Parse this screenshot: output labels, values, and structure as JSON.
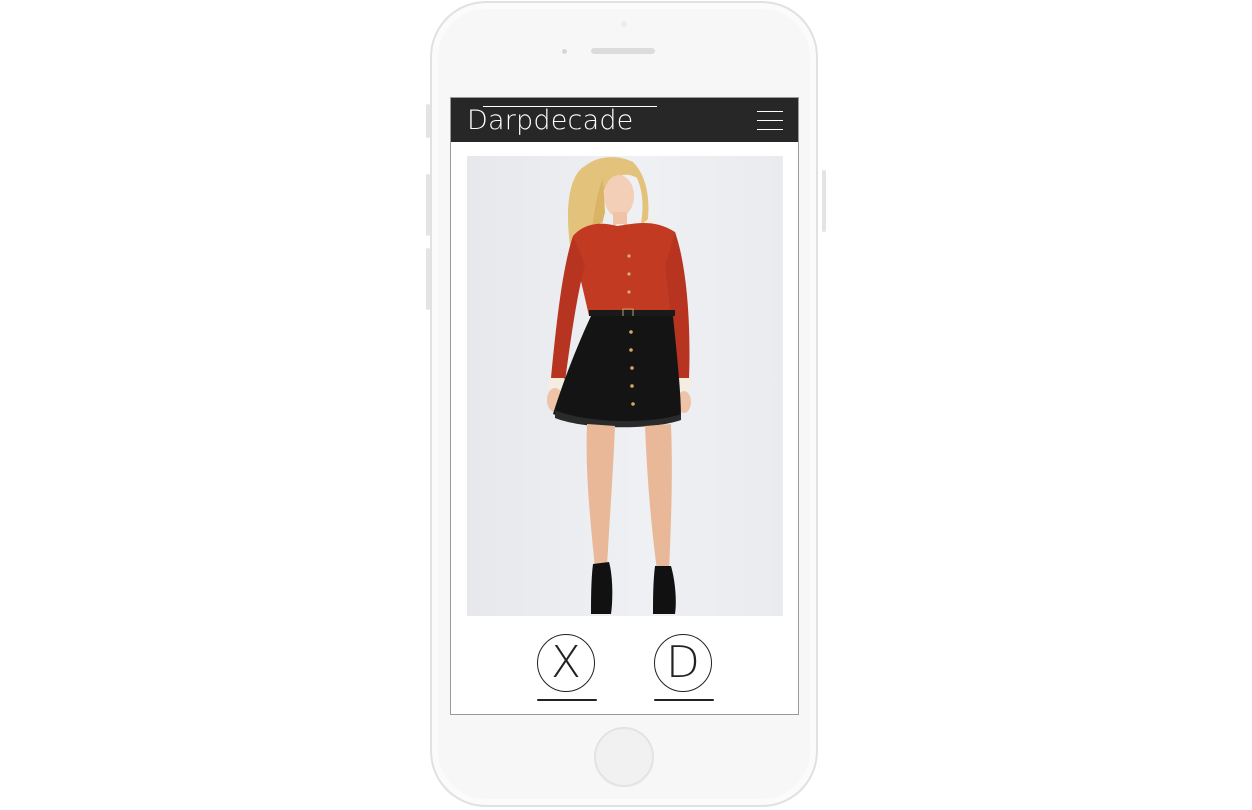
{
  "app": {
    "logo_text": "Darpdecade"
  },
  "actions": {
    "reject_label": "X",
    "like_label": "D"
  },
  "colors": {
    "header_bg": "#272727",
    "header_text": "#ffffff",
    "blouse": "#c23a22",
    "skirt": "#141414"
  },
  "icons": {
    "menu": "hamburger-menu-icon",
    "reject": "x-circle-icon",
    "like": "d-circle-icon"
  }
}
